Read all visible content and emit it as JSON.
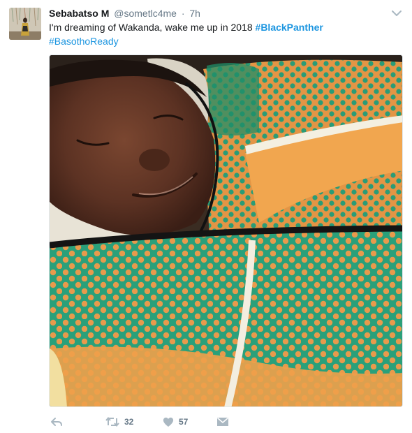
{
  "tweet": {
    "author_name": "Sebabatso M",
    "handle": "@sometlc4me",
    "separator": "·",
    "timestamp": "7h",
    "text_plain": "I'm dreaming of Wakanda, wake me up in 2018 ",
    "hashtag_1": "#BlackPanther",
    "hashtag_2": "#BasothoReady",
    "retweet_count": "32",
    "like_count": "57"
  },
  "icons": {
    "avatar": "avatar",
    "more": "chevron-down-icon",
    "reply": "reply-icon",
    "retweet": "retweet-icon",
    "like": "heart-icon",
    "dm": "envelope-icon"
  },
  "colors": {
    "name": "#14171a",
    "secondary": "#657786",
    "link": "#1b95e0",
    "icon": "#aab8c2",
    "blanket_orange": "#e89a4c",
    "blanket_green": "#2aa07a"
  }
}
